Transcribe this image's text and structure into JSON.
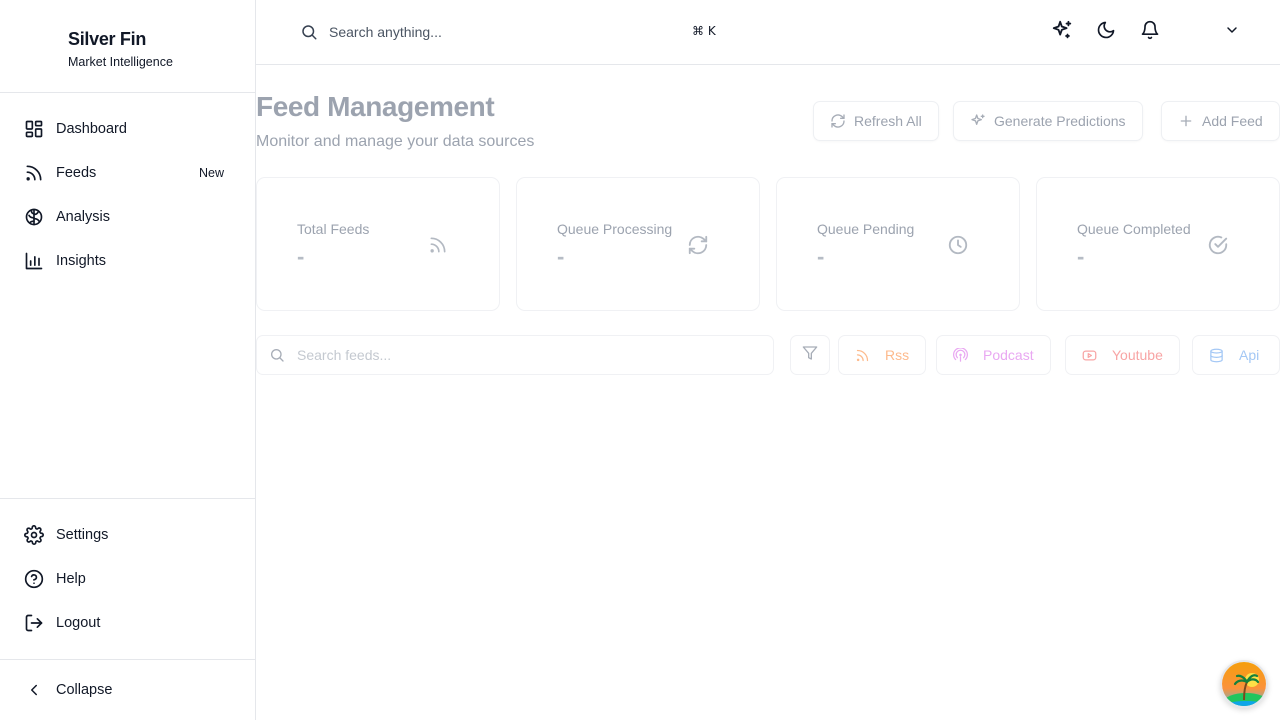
{
  "brand": {
    "name": "Silver Fin",
    "tagline": "Market Intelligence"
  },
  "sidebar": {
    "items": [
      {
        "label": "Dashboard",
        "icon": "dashboard-grid-icon"
      },
      {
        "label": "Feeds",
        "icon": "rss-icon",
        "badge": "New"
      },
      {
        "label": "Analysis",
        "icon": "brain-icon"
      },
      {
        "label": "Insights",
        "icon": "bar-chart-icon"
      }
    ],
    "bottom": [
      {
        "label": "Settings",
        "icon": "gear-icon"
      },
      {
        "label": "Help",
        "icon": "help-circle-icon"
      },
      {
        "label": "Logout",
        "icon": "logout-icon"
      }
    ],
    "collapse_label": "Collapse"
  },
  "topbar": {
    "search_placeholder": "Search anything...",
    "shortcut": "⌘ K"
  },
  "page": {
    "title": "Feed Management",
    "subtitle": "Monitor and manage your data sources",
    "buttons": {
      "refresh": "Refresh All",
      "predict": "Generate Predictions",
      "add": "Add Feed"
    }
  },
  "stats": [
    {
      "label": "Total Feeds",
      "value": "-",
      "icon": "rss-icon"
    },
    {
      "label": "Queue Processing",
      "value": "-",
      "icon": "refresh-icon"
    },
    {
      "label": "Queue Pending",
      "value": "-",
      "icon": "clock-icon"
    },
    {
      "label": "Queue Completed",
      "value": "-",
      "icon": "check-circle-icon"
    }
  ],
  "filters": {
    "search_placeholder": "Search feeds...",
    "chips": [
      {
        "label": "Rss",
        "color": "#fdba8c"
      },
      {
        "label": "Podcast",
        "color": "#e9a8f2"
      },
      {
        "label": "Youtube",
        "color": "#f8a5a5"
      },
      {
        "label": "Api",
        "color": "#a4c8f5"
      }
    ]
  }
}
